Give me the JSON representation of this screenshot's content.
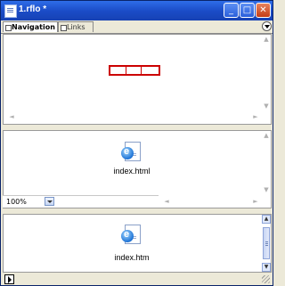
{
  "window": {
    "title": "1.rflo *",
    "minimize_icon": "minimize-icon",
    "maximize_icon": "maximize-icon",
    "close_icon": "close-icon"
  },
  "tabs": [
    {
      "label": "Navigation",
      "active": true
    },
    {
      "label": "Links",
      "active": false
    }
  ],
  "panel_menu_icon": "panel-menu-icon",
  "middle_pane": {
    "file_name": "index.html",
    "zoom": "100%"
  },
  "bottom_pane": {
    "file_name": "index.htm"
  },
  "colors": {
    "titlebar": "#1B4DC8",
    "navigation_frame": "#CC0000",
    "background": "#ECE9D8"
  }
}
